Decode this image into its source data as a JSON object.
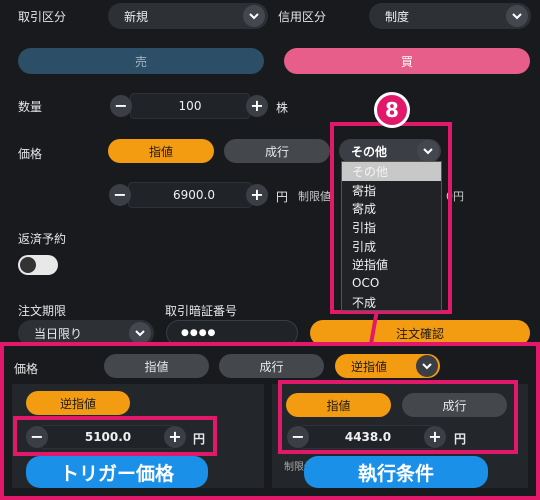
{
  "top": {
    "trade_type_label": "取引区分",
    "trade_type_value": "新規",
    "credit_type_label": "信用区分",
    "credit_type_value": "制度",
    "sell_label": "売",
    "buy_label": "買"
  },
  "quantity": {
    "label": "数量",
    "value": "100",
    "unit": "株"
  },
  "price": {
    "label": "価格",
    "limit_label": "指値",
    "market_label": "成行",
    "other_value": "その他",
    "price_value": "6900.0",
    "unit": "円",
    "limit_range_label": "制限値",
    "limit_range_unit_tail": "0円"
  },
  "dropdown": {
    "items": [
      "その他",
      "寄指",
      "寄成",
      "引指",
      "引成",
      "逆指値",
      "OCO",
      "不成"
    ]
  },
  "badge_number": "8",
  "settle": {
    "label": "返済予約"
  },
  "order": {
    "period_label": "注文期限",
    "period_value": "当日限り",
    "password_label": "取引暗証番号",
    "password_mask": "●●●●",
    "confirm_label": "注文確認"
  },
  "bottom": {
    "price_label": "価格",
    "limit_label": "指値",
    "market_label": "成行",
    "stop_value": "逆指値",
    "trigger": {
      "button_label": "逆指値",
      "value": "5100.0",
      "unit": "円"
    },
    "exec": {
      "limit_label": "指値",
      "market_label": "成行",
      "value": "4438.0",
      "unit": "円",
      "partial_text": "制限値"
    },
    "trigger_tag": "トリガー価格",
    "exec_tag": "執行条件"
  },
  "colors": {
    "accent_orange": "#f39c12",
    "pink": "#e2196a",
    "sell": "#2c4e66",
    "buy": "#e75e8a",
    "tag_blue": "#1a90e9"
  }
}
